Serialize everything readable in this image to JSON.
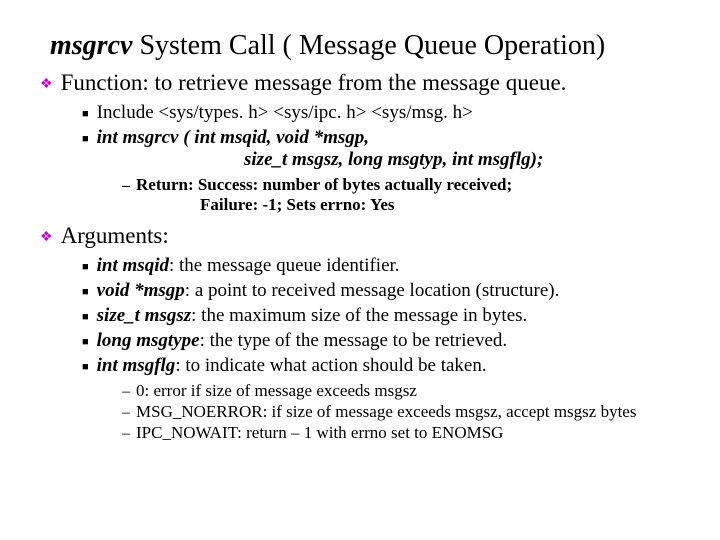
{
  "title": {
    "em": "msgrcv",
    "rest": " System Call ( Message Queue Operation)"
  },
  "s1": {
    "head": "Function: to retrieve message from the message queue.",
    "inc_label": "Include ",
    "inc_files": "<sys/types. h>  <sys/ipc. h>  <sys/msg. h>",
    "sig1": "int msgrcv ( int  msqid,  void  *msgp,",
    "sig2": "size_t  msgsz,  long  msgtyp, int  msgflg);",
    "ret1": "Return: Success:  number of bytes actually received;",
    "ret2": "Failure:  -1;  Sets errno:  Yes"
  },
  "s2": {
    "head": "Arguments:",
    "a1b": "int  msqid",
    "a1t": ": the message queue identifier.",
    "a2b": "void *msgp",
    "a2t": ": a point to received message location (structure).",
    "a3b": "size_t  msgsz",
    "a3t": ": the maximum size of the message in bytes.",
    "a4b": "long  msgtype",
    "a4t": ": the type of the message to be retrieved.",
    "a5b": "int msgflg",
    "a5t": ": to indicate what action should be taken.",
    "f1": "0:  error if size of message exceeds msgsz",
    "f2": "MSG_NOERROR: if size of message exceeds msgsz, accept msgsz bytes",
    "f3": "IPC_NOWAIT: return – 1 with errno set to ENOMSG"
  }
}
